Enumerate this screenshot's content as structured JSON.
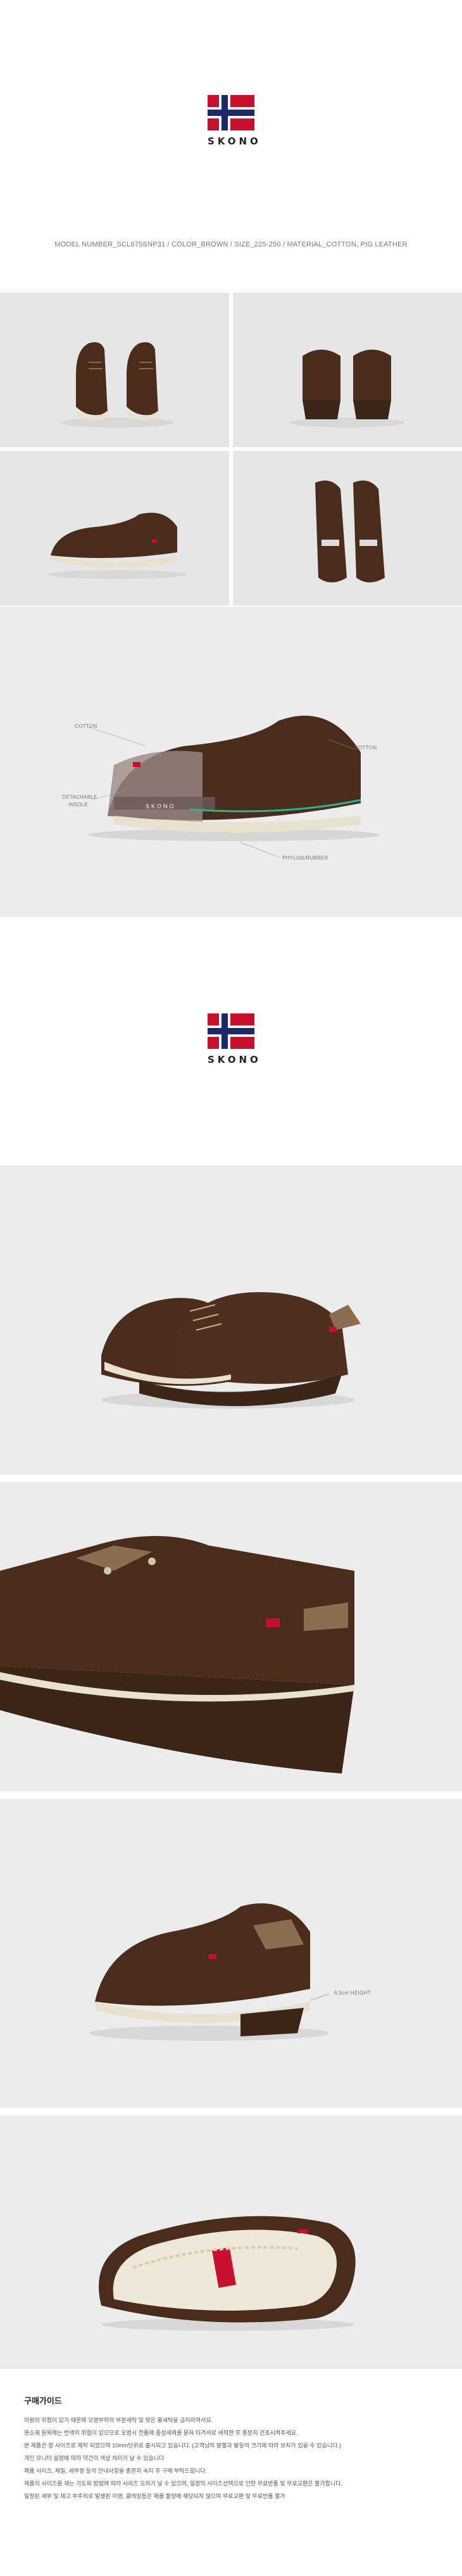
{
  "brand": {
    "name": "SKONO"
  },
  "product": {
    "spec_line": "MODEL NUMBER_SCL675SNP31 / COLOR_BROWN / SIZE_225-250 / MATERIAL_COTTON, PIG LEATHER"
  },
  "detail_callouts": {
    "top_left": "COTTON",
    "top_right": "COTTON",
    "side_left_1": "DETACHABLE",
    "side_left_2": "INSOLE",
    "bottom": "PHYLON/RUBBER"
  },
  "heel_callout": "6.5cm HEIGHT",
  "colors": {
    "shoe_brown": "#4a2c1c",
    "sole_brown": "#3b2418",
    "flag_red": "#c8102e",
    "flag_blue": "#1c2a6b"
  },
  "purchase_guide": {
    "title": "구매가이드",
    "lines": [
      "이원의 위험이 있기 때문에 오염부위의 부분세탁 및 젖은 물세탁을 금지하여서요.",
      "원소재 원목에는 번색의 위험이 있으므로 오염시 전품에 중성세제를 묻혀 타겨서로 세척한 후 충분히 건조시켜주세요.",
      "본 제품은 정 사이즈로 제작 되었으며 10mm단위로 출시되고 있습니다. (고객님의 발볼과 발등의 크기에 따라 모치가 있을 수 있습니다.)",
      "개인 모니터 설정에 따라 약간의 색상 차이가 날 수 있습니다",
      "제품 사이즈, 재질, 세부정 등의 안내사항을 충분히 숙지 후 구매 부탁드립니다.",
      "제품의 사이즈를 재는 기도와 방법에 따라 사이즈 오차가 날 수 있으며, 일정의 사이즈선택으로 인한 무료반품 및 무료교환은 불가합니다.",
      "일정된 세부 및 재고 부주의로 발생된 이염, 클레임등은 제품 불량에 해당되지 않으며 무료교환 및 무료반품 불가"
    ]
  }
}
